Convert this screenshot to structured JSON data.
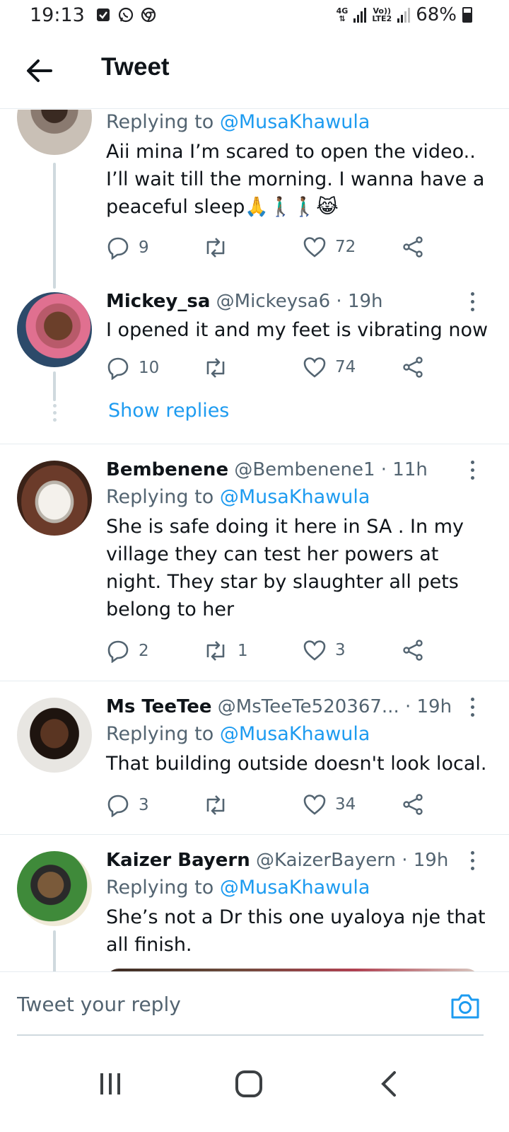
{
  "status_bar": {
    "time": "19:13",
    "network_top": "4G",
    "network_volte": "Vo))",
    "network_lte": "LTE2",
    "battery": "68%"
  },
  "header": {
    "title": "Tweet"
  },
  "tweets": [
    {
      "name": "",
      "handle": "",
      "time": "",
      "replying_prefix": "Replying to",
      "replying_to": "@MusaKhawula",
      "text": "Aii mina I’m scared to open the video.. I’ll wait till the morning. I wanna have a peaceful sleep🙏🚶🏾‍♂️🚶🏾‍♂️😹",
      "replies": "9",
      "retweets": "",
      "likes": "72"
    },
    {
      "name": "Mickey_sa",
      "handle": "@Mickeysa6",
      "time": "19h",
      "text": "I opened it and my feet is vibrating now",
      "replies": "10",
      "retweets": "",
      "likes": "74"
    },
    {
      "name": "Bembenene",
      "handle": "@Bembenene1",
      "time": "11h",
      "replying_prefix": "Replying to",
      "replying_to": "@MusaKhawula",
      "text": "She is safe doing it here in SA . In my village they can test her powers at night. They star by slaughter all pets belong to her",
      "replies": "2",
      "retweets": "1",
      "likes": "3"
    },
    {
      "name": "Ms TeeTee",
      "handle": "@MsTeeTe520367...",
      "time": "19h",
      "replying_prefix": "Replying to",
      "replying_to": "@MusaKhawula",
      "text": "That building outside doesn't look local.",
      "replies": "3",
      "retweets": "",
      "likes": "34"
    },
    {
      "name": "Kaizer Bayern",
      "handle": "@KaizerBayern",
      "time": "19h",
      "replying_prefix": "Replying to",
      "replying_to": "@MusaKhawula",
      "text": "She’s not a Dr this one uyaloya nje that all finish."
    }
  ],
  "show_replies": "Show replies",
  "separator": "·",
  "compose": {
    "placeholder": "Tweet your reply"
  },
  "icons": {
    "back": "arrow-left-icon",
    "reply": "speech-bubble-icon",
    "retweet": "retweet-icon",
    "like": "heart-icon",
    "share": "share-icon",
    "more": "more-vertical-icon",
    "camera": "camera-icon"
  },
  "colors": {
    "accent": "#1d9bf0",
    "secondary_text": "#536471",
    "thread_line": "#cfd9de"
  }
}
